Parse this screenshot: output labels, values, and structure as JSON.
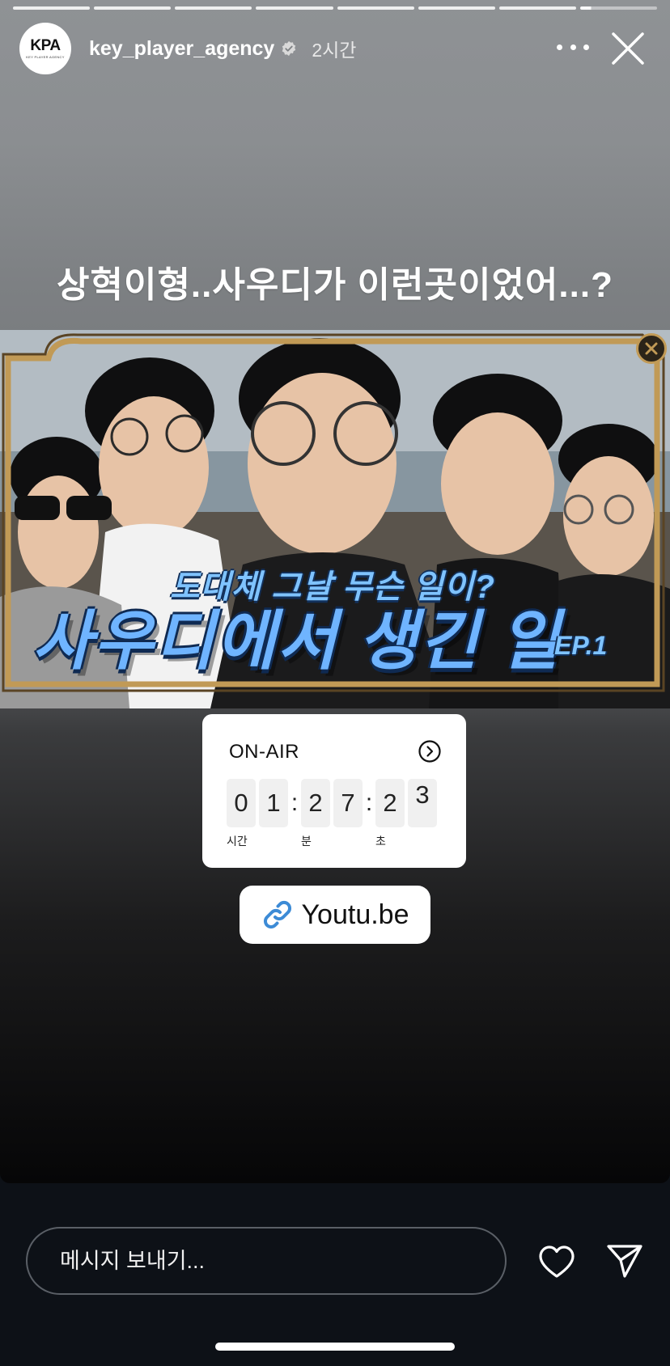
{
  "progress": {
    "segments": 8,
    "current_index": 7,
    "current_fraction": 0.14
  },
  "header": {
    "avatar_logo": "KPA",
    "avatar_logo_sub": "KEY PLAYER AGENCY",
    "username": "key_player_agency",
    "verified": true,
    "time": "2시간",
    "more_icon": "more-icon",
    "close_icon": "close-icon"
  },
  "caption": "상혁이형..사우디가 이런곳이었어...?",
  "thumbnail": {
    "subtitle": "도대체 그날 무슨 일이?",
    "title": "사우디에서 생긴 일",
    "episode": "EP.1",
    "dismiss_icon": "close-icon"
  },
  "countdown": {
    "label": "ON-AIR",
    "go_icon": "chevron-right-circle-icon",
    "digits": [
      "0",
      "1",
      "2",
      "7",
      "2",
      "3"
    ],
    "units": [
      "시간",
      "분",
      "초"
    ]
  },
  "link": {
    "icon": "link-icon",
    "text": "Youtu.be"
  },
  "footer": {
    "message_placeholder": "메시지 보내기...",
    "like_icon": "heart-icon",
    "share_icon": "send-icon"
  },
  "colors": {
    "footer_bg": "#0d1117",
    "link_icon": "#3d8bd6",
    "thumbnail_frame": "#c19a56"
  }
}
